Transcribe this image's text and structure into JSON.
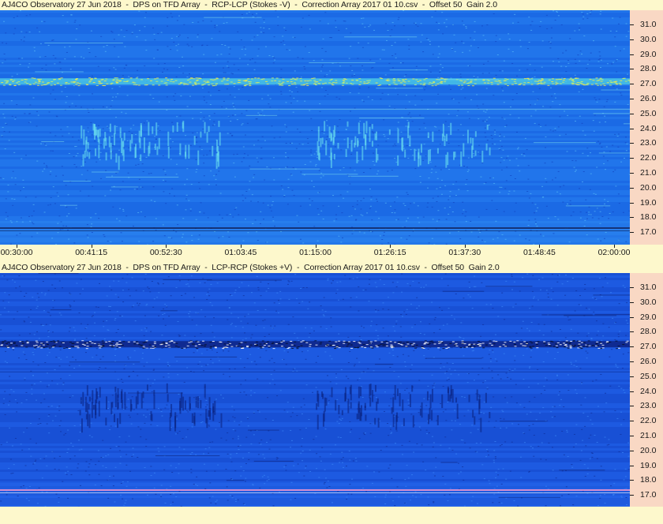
{
  "panel_top": {
    "title": "AJ4CO Observatory 27 Jun 2018  -  DPS on TFD Array  -  RCP-LCP (Stokes -V)  -  Correction Array 2017 01 10.csv  -  Offset 50  Gain 2.0",
    "base_color": "#1c6fe8",
    "feature_color": "#6fe7ef",
    "hot_color": "#f2e64a"
  },
  "panel_bottom": {
    "title": "AJ4CO Observatory 27 Jun 2018  -  DPS on TFD Array  -  LCP-RCP (Stokes +V)  -  Correction Array 2017 01 10.csv  -  Offset 50  Gain 2.0",
    "base_color": "#1a55dc",
    "feature_color": "#0a1f7a",
    "hot_color": "#0a1440"
  },
  "frequency_axis": {
    "labels": [
      "31.0",
      "30.0",
      "29.0",
      "28.0",
      "27.0",
      "26.0",
      "25.0",
      "24.0",
      "23.0",
      "22.0",
      "21.0",
      "20.0",
      "19.0",
      "18.0",
      "17.0"
    ]
  },
  "time_axis": {
    "labels": [
      "00:30:00",
      "00:41:15",
      "00:52:30",
      "01:03:45",
      "01:15:00",
      "01:26:15",
      "01:37:30",
      "01:48:45",
      "02:00:00"
    ]
  }
}
